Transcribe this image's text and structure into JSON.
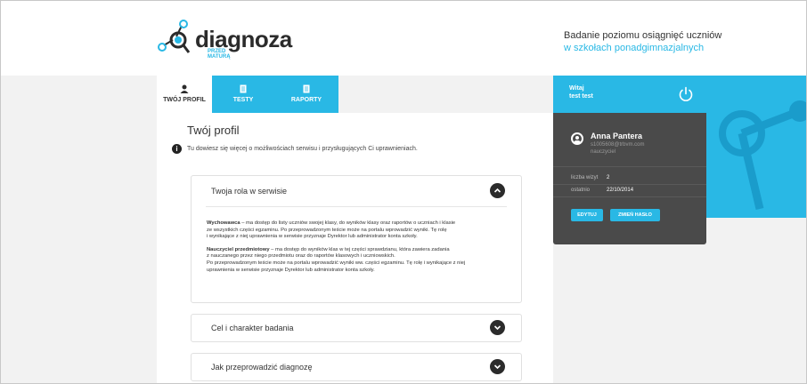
{
  "header": {
    "logo": {
      "wordmark": "diagnoza",
      "sub_line1": "PRZED",
      "sub_line2": "MATURĄ",
      "colors": {
        "brand_blue": "#29b8e5",
        "wordmark": "#2b2b2b"
      }
    },
    "tagline_line1": "Badanie poziomu osiągnięć uczniów",
    "tagline_line2": "w szkołach ponadgimnazjalnych"
  },
  "tabs": [
    {
      "label": "TWÓJ PROFIL",
      "icon": "person-icon",
      "active": true
    },
    {
      "label": "TESTY",
      "icon": "document-icon",
      "active": false
    },
    {
      "label": "RAPORTY",
      "icon": "document-icon",
      "active": false
    }
  ],
  "user_bar": {
    "greeting": "Witaj",
    "username": "test test",
    "logout_icon": "power-icon"
  },
  "main": {
    "title": "Twój profil",
    "info_text": "Tu dowiesz się więcej o możliwościach serwisu i przysługujących Ci uprawnieniach.",
    "accordion": [
      {
        "title": "Twoja rola w serwisie",
        "expanded": true,
        "paragraphs": [
          {
            "lead": "Wychowawca",
            "l1": " – ma dostęp do listy uczniów swojej klasy, do wyników klasy oraz raportów o uczniach i klasie",
            "l2": "ze wszystkich części egzaminu. Po przeprowadzonym teście może na portalu wprowadzić wyniki. Tę rolę",
            "l3": "i wynikające z niej uprawnienia w serwisie przyznaje Dyrektor lub administrator konta szkoły."
          },
          {
            "lead": "Nauczyciel przedmiotowy",
            "l1": " – ma dostęp do wyników klas w tej części sprawdzianu, która zawiera zadania",
            "l2": "z nauczanego przez niego przedmiotu oraz do raportów klasowych i uczniowskich.",
            "l3": "Po przeprowadzonym teście może na portalu wprowadzić wyniki ww. części egzaminu. Tę rolę i wynikające z niej",
            "l4": "uprawnienia w serwisie przyznaje Dyrektor lub administrator konta szkoły."
          }
        ]
      },
      {
        "title": "Cel i charakter badania",
        "expanded": false
      },
      {
        "title": "Jak przeprowadzić diagnozę",
        "expanded": false
      }
    ]
  },
  "profile_card": {
    "name": "Anna Pantera",
    "email": "s1005608@trbvm.com",
    "role": "nauczyciel",
    "stats": [
      {
        "label": "liczba wizyt",
        "value": "2"
      },
      {
        "label": "ostatnio",
        "value": "22/10/2014"
      }
    ],
    "edit_button": "EDYTUJ",
    "change_password_button": "ZMIEŃ HASŁO"
  }
}
